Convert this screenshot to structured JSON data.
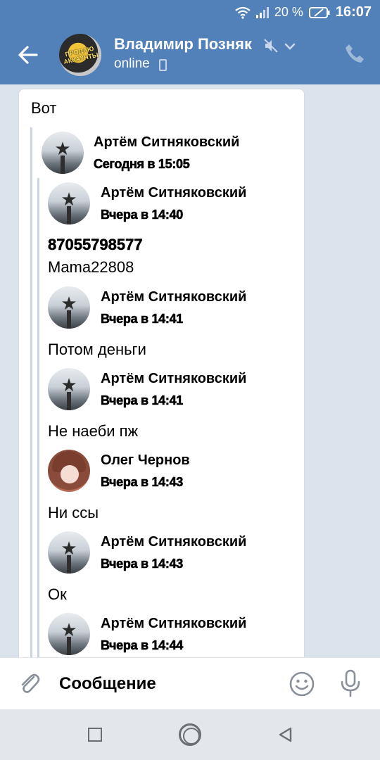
{
  "status_bar": {
    "battery_percent": "20 %",
    "time": "16:07",
    "icons": [
      "wifi-icon",
      "signal-icon",
      "battery-icon"
    ]
  },
  "header": {
    "avatar_text": "ПРОДАЮ АККАУНТЫ",
    "name": "Владимир Позняк",
    "status": "online",
    "icons": [
      "back-arrow-icon",
      "mute-icon",
      "chevron-down-icon",
      "mobile-icon",
      "phone-icon"
    ]
  },
  "message": {
    "text": "Вот",
    "forward": {
      "author": "Артём Ситняковский",
      "time": "Сегодня в 15:05",
      "items": [
        {
          "author": "Артём Ситняковский",
          "time": "Вчера в 14:40",
          "lines": [
            "87055798577",
            "Mama22808"
          ]
        },
        {
          "author": "Артём Ситняковский",
          "time": "Вчера в 14:41",
          "lines": [
            "Потом деньги"
          ]
        },
        {
          "author": "Артём Ситняковский",
          "time": "Вчера в 14:41",
          "lines": [
            "Не наеби пж"
          ]
        },
        {
          "author": "Олег Чернов",
          "time": "Вчера в 14:43",
          "lines": [
            "Ни ссы"
          ]
        },
        {
          "author": "Артём Ситняковский",
          "time": "Вчера в 14:43",
          "lines": [
            "Ок"
          ]
        },
        {
          "author": "Артём Ситняковский",
          "time": "Вчера в 14:44",
          "lines": []
        }
      ]
    }
  },
  "input": {
    "placeholder": "Сообщение",
    "value": "",
    "icons": [
      "paperclip-icon",
      "emoji-icon",
      "microphone-icon"
    ]
  },
  "nav": {
    "icons": [
      "recent-apps-icon",
      "home-icon",
      "back-triangle-icon"
    ]
  },
  "colors": {
    "header": "#5181b8",
    "chat_background": "#dbe3ec",
    "bubble": "#ffffff",
    "forward_line": "#cbd6e3"
  }
}
